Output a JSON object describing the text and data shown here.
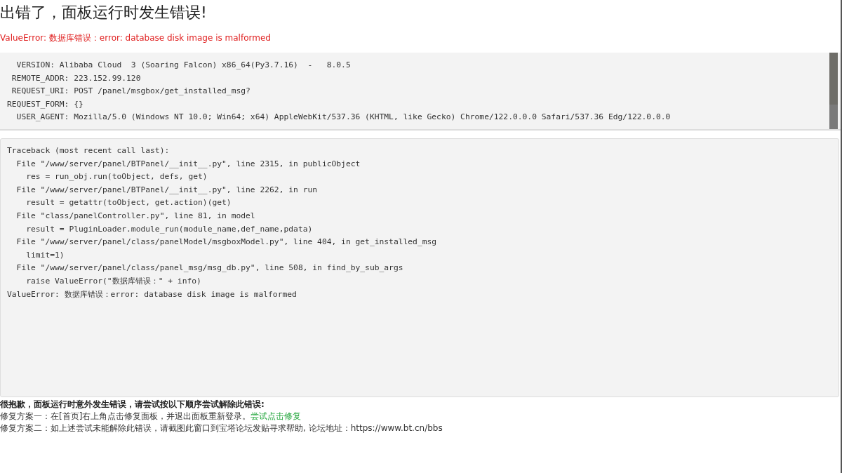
{
  "title": "出错了，面板运行时发生错误!",
  "error_message": "ValueError: 数据库错误：error: database disk image is malformed",
  "request_info": [
    "  VERSION: Alibaba Cloud  3 (Soaring Falcon) x86_64(Py3.7.16)  -   8.0.5",
    " REMOTE_ADDR: 223.152.99.120",
    " REQUEST_URI: POST /panel/msgbox/get_installed_msg?",
    "REQUEST_FORM: {}",
    "  USER_AGENT: Mozilla/5.0 (Windows NT 10.0; Win64; x64) AppleWebKit/537.36 (KHTML, like Gecko) Chrome/122.0.0.0 Safari/537.36 Edg/122.0.0.0"
  ],
  "traceback": [
    "Traceback (most recent call last):",
    "  File \"/www/server/panel/BTPanel/__init__.py\", line 2315, in publicObject",
    "    res = run_obj.run(toObject, defs, get)",
    "  File \"/www/server/panel/BTPanel/__init__.py\", line 2262, in run",
    "    result = getattr(toObject, get.action)(get)",
    "  File \"class/panelController.py\", line 81, in model",
    "    result = PluginLoader.module_run(module_name,def_name,pdata)",
    "  File \"/www/server/panel/class/panelModel/msgboxModel.py\", line 404, in get_installed_msg",
    "    limit=1)",
    "  File \"/www/server/panel/class/panel_msg/msg_db.py\", line 508, in find_by_sub_args",
    "    raise ValueError(\"数据库错误：\" + info)",
    "ValueError: 数据库错误：error: database disk image is malformed"
  ],
  "help": {
    "heading": "很抱歉，面板运行时意外发生错误，请尝试按以下顺序尝试解除此错误:",
    "option_1": {
      "text": "修复方案一：在[首页]右上角点击修复面板，并退出面板重新登录。",
      "link": "尝试点击修复"
    },
    "option_2": "修复方案二：如上述尝试未能解除此错误，请截图此窗口到宝塔论坛发贴寻求帮助, 论坛地址：https://www.bt.cn/bbs"
  }
}
